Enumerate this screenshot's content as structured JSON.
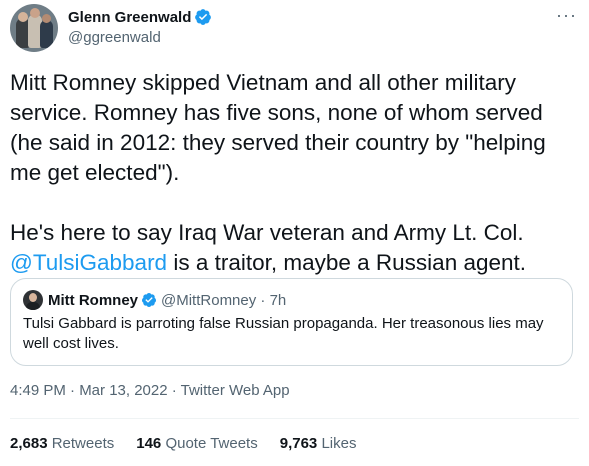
{
  "author": {
    "name": "Glenn Greenwald",
    "handle": "@ggreenwald",
    "verified": true
  },
  "more_icon": "more-horizontal-icon",
  "tweet": {
    "text_part1": "Mitt Romney skipped Vietnam and all other military service. Romney has five sons, none of whom served (he said in 2012: they served their country by \"helping me get elected\").\n\nHe's here to say Iraq War veteran and Army Lt. Col. ",
    "mention": "@TulsiGabbard",
    "text_part2": " is a traitor, maybe a Russian agent."
  },
  "quote": {
    "name": "Mitt Romney",
    "handle_time": "@MittRomney · 7h",
    "text": "Tulsi Gabbard is parroting false Russian propaganda. Her treasonous lies may well cost lives."
  },
  "meta": {
    "time": "4:49 PM · Mar 13, 2022 · ",
    "app": "Twitter Web App"
  },
  "stats": {
    "retweets_count": "2,683",
    "retweets_label": " Retweets",
    "quotes_count": "146",
    "quotes_label": " Quote Tweets",
    "likes_count": "9,763",
    "likes_label": " Likes"
  },
  "colors": {
    "accent": "#1d9bf0",
    "text": "#0f1419",
    "secondary": "#536471",
    "border": "#cfd9de"
  }
}
